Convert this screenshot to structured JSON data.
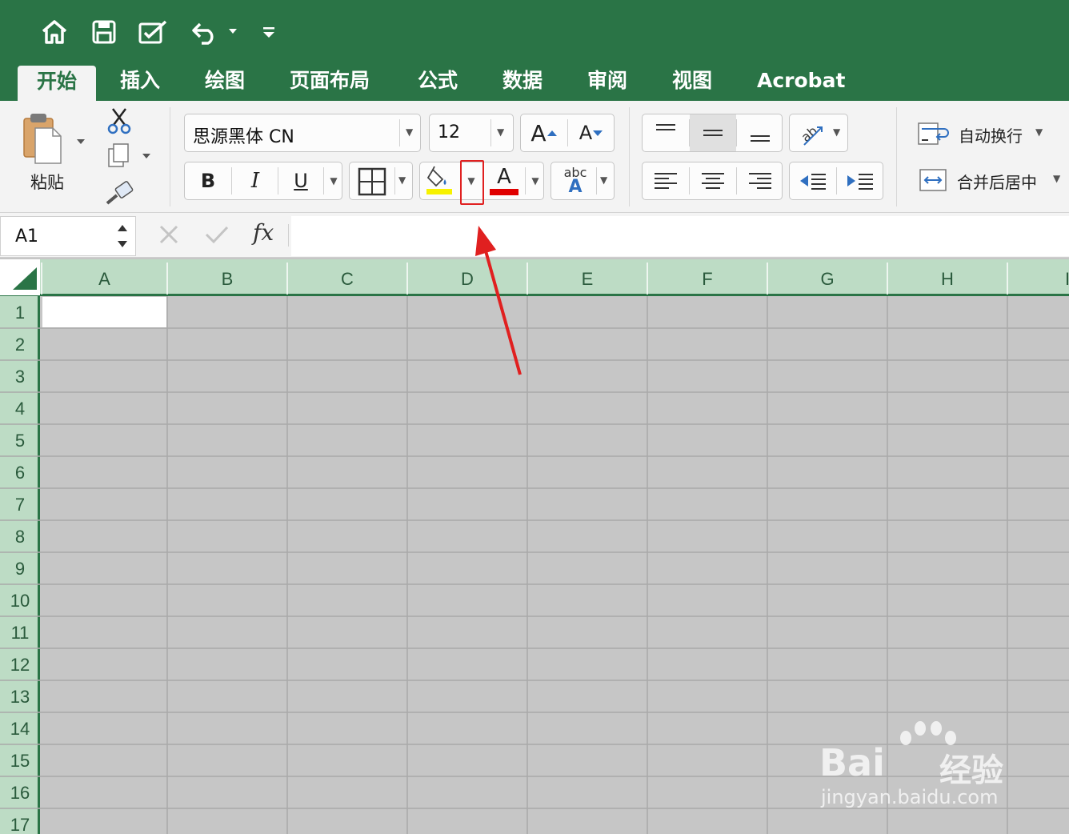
{
  "quick_access": [
    "home-icon",
    "save-icon",
    "edit-icon",
    "undo-icon",
    "customize-icon"
  ],
  "tabs": [
    "开始",
    "插入",
    "绘图",
    "页面布局",
    "公式",
    "数据",
    "审阅",
    "视图",
    "Acrobat"
  ],
  "ribbon": {
    "paste_label": "粘贴",
    "font_name": "思源黑体 CN",
    "font_size": "12",
    "bold": "B",
    "italic": "I",
    "underline": "U",
    "font_color_glyph": "A",
    "grow_font": "A",
    "shrink_font": "A",
    "abc_top": "abc",
    "abc_bottom": "A",
    "wrap_text": "自动换行",
    "merge_center": "合并后居中",
    "fill_color": "#f7f200",
    "font_color": "#e00000"
  },
  "formula_bar": {
    "name_box": "A1",
    "fx": "fx"
  },
  "sheet": {
    "columns": [
      "A",
      "B",
      "C",
      "D",
      "E",
      "F",
      "G",
      "H",
      "I"
    ],
    "rows": [
      "1",
      "2",
      "3",
      "4",
      "5",
      "6",
      "7",
      "8",
      "9",
      "10",
      "11",
      "12",
      "13",
      "14",
      "15",
      "16",
      "17"
    ]
  },
  "watermark": {
    "logo_text": "Bai",
    "logo_text2": "经验",
    "url": "jingyan.baidu.com"
  },
  "accent_colors": {
    "brand_green": "#2a7446",
    "header_green": "#bddcc5",
    "highlight_red": "#e02020"
  }
}
